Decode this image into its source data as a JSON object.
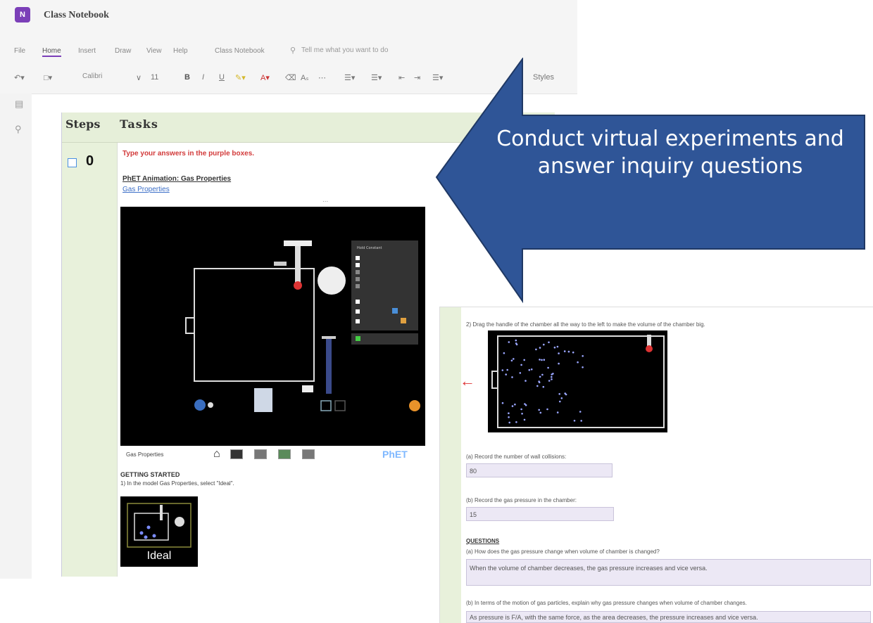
{
  "app": {
    "title": "Class Notebook",
    "icon_letter": "N"
  },
  "menu": {
    "items": [
      "File",
      "Home",
      "Insert",
      "Draw",
      "View",
      "Help",
      "Class Notebook"
    ],
    "tell_me": "Tell me what you want to do"
  },
  "toolbar": {
    "font_name": "Calibri",
    "font_size": "11",
    "bold": "B",
    "italic": "I",
    "underline": "U",
    "styles": "Styles"
  },
  "table": {
    "header_steps": "Steps",
    "header_tasks": "Tasks",
    "step_number": "0",
    "instruction": "Type your answers in the purple boxes.",
    "sim_heading": "PhET Animation: Gas Properties",
    "sim_link": "Gas Properties",
    "ellipsis": "...",
    "sim_bar_label": "Gas Properties",
    "phet_logo": "PhET",
    "getting_started": "GETTING STARTED",
    "step1_text": "1) In the model Gas Properties, select \"Ideal\".",
    "ideal_label": "Ideal"
  },
  "callout": {
    "text": "Conduct virtual experiments and answer inquiry questions",
    "fill_color": "#2f5597",
    "stroke_color": "#1f3864"
  },
  "worksheet": {
    "step2": "2) Drag the handle of the chamber all the way to the left to make the volume of the chamber big.",
    "qa_label": "(a) Record the number of wall collisions:",
    "qa_value": "80",
    "qb_label": "(b) Record the gas pressure in the chamber:",
    "qb_value": "15",
    "questions_heading": "QUESTIONS",
    "q1_label": "(a) How does the gas pressure change when volume of chamber is changed?",
    "q1_value": "When the volume of chamber decreases, the gas pressure increases and vice versa.",
    "q2_label": "(b) In terms of the motion of gas particles, explain why gas pressure changes when volume of chamber changes.",
    "q2_value": "As pressure is F/A, with the same force, as the area decreases, the pressure increases and vice versa."
  }
}
